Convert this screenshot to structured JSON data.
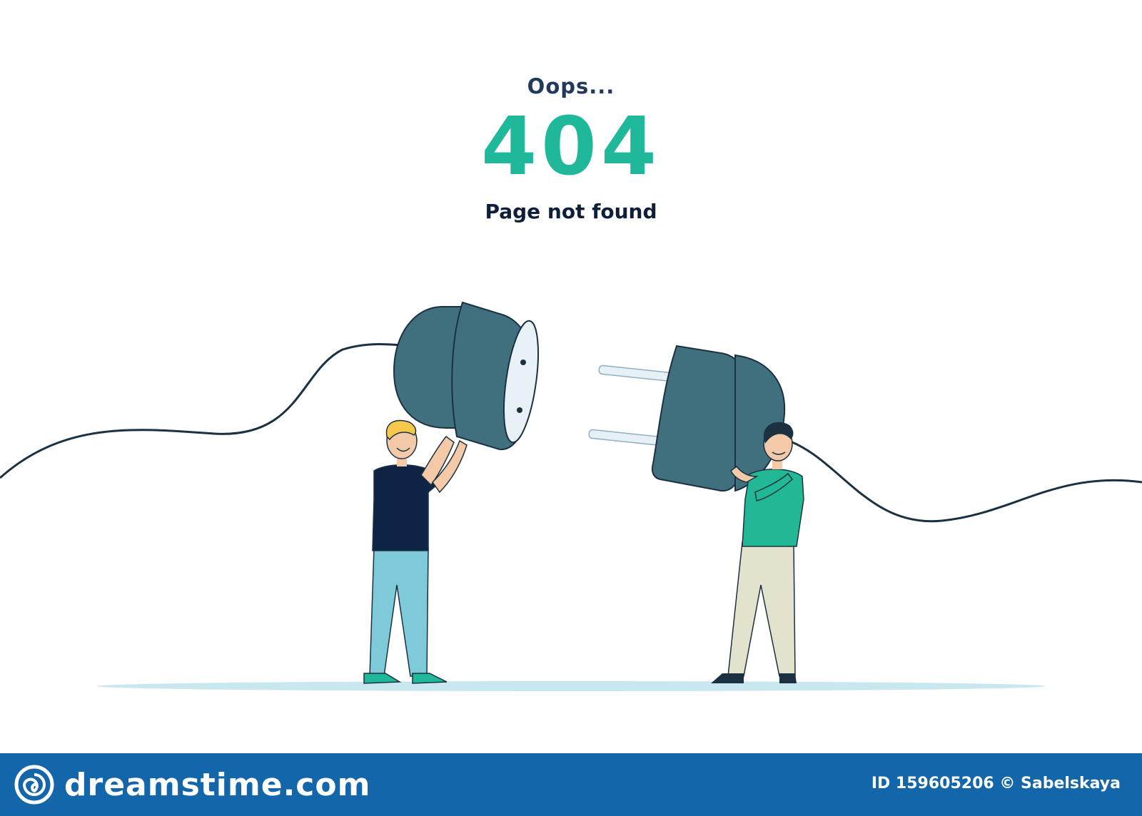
{
  "message": {
    "oops": "Oops...",
    "code": "404",
    "subtitle": "Page not found"
  },
  "footer": {
    "brand": "dreamstime.com",
    "credit": "ID 159605206 © Sabelskaya"
  },
  "colors": {
    "accent": "#1fb89a",
    "heading": "#23395b",
    "footer_bg": "#1366a9",
    "plug": "#40707e",
    "cable": "#1b3142"
  },
  "icons": [
    "dreamstime-logo-icon"
  ]
}
